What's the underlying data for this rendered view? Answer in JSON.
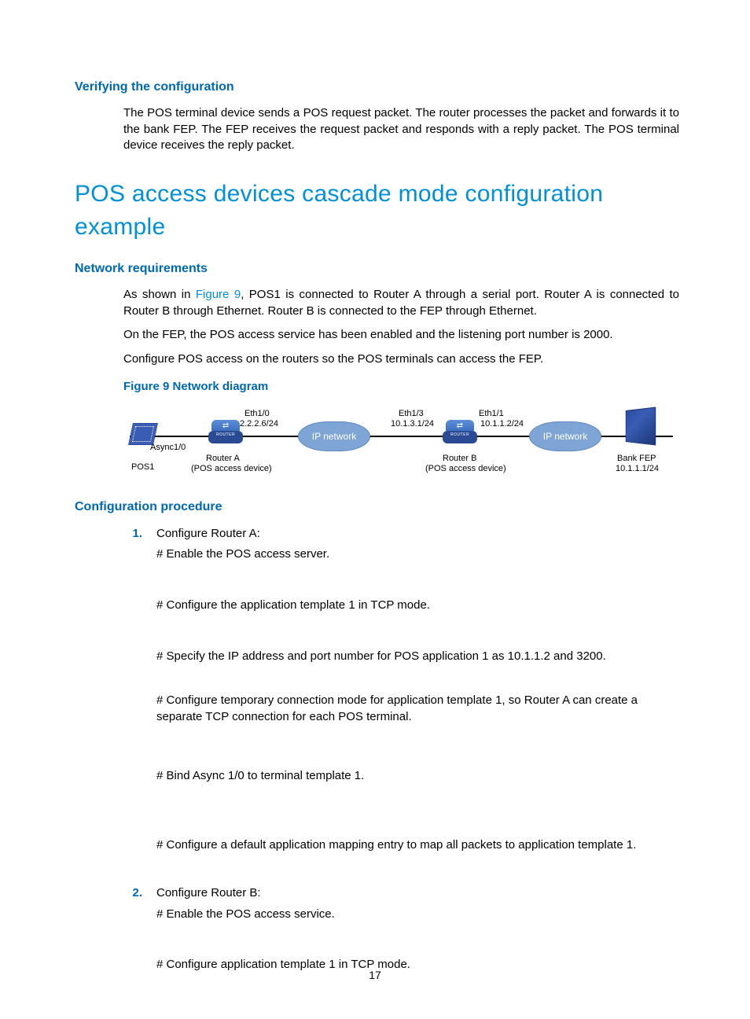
{
  "sec1": {
    "title": "Verifying the configuration",
    "p1": "The POS terminal device sends a POS request packet. The router processes the packet and forwards it to the bank FEP. The FEP receives the request packet and responds with a reply packet. The POS terminal device receives the reply packet."
  },
  "h2": "POS access devices cascade mode configuration example",
  "sec2": {
    "title": "Network requirements",
    "p1a": "As shown in ",
    "figref": "Figure 9",
    "p1b": ", POS1 is connected to Router A through a serial port. Router A is connected to Router B through Ethernet. Router B is connected to the FEP through Ethernet.",
    "p2": "On the FEP, the POS access service has been enabled and the listening port number is 2000.",
    "p3": "Configure POS access on the routers so the POS terminals can access the FEP."
  },
  "figcap": "Figure 9 Network diagram",
  "diagram": {
    "pos1_iface": "Async1/0",
    "pos1": "POS1",
    "ra_eth": "Eth1/0",
    "ra_ip": "2.2.2.6/24",
    "ra_name": "Router  A",
    "ra_sub": "(POS access device)",
    "cloud1": "IP network",
    "rb_left_eth": "Eth1/3",
    "rb_left_ip": "10.1.3.1/24",
    "rb_right_eth": "Eth1/1",
    "rb_right_ip": "10.1.1.2/24",
    "rb_name": "Router B",
    "rb_sub": "(POS access device)",
    "cloud2": "IP network",
    "fep_name": "Bank FEP",
    "fep_ip": "10.1.1.1/24"
  },
  "sec3": {
    "title": "Configuration procedure",
    "items": [
      {
        "num": "1.",
        "title": "Configure Router A:",
        "steps": [
          "# Enable the POS access server.",
          "# Configure the application template 1 in TCP mode.",
          "# Specify the IP address and port number for POS application 1 as 10.1.1.2 and 3200.",
          "# Configure temporary connection mode for application template 1, so Router A can create a separate TCP connection for each POS terminal.",
          "# Bind Async 1/0 to terminal template 1.",
          "# Configure a default application mapping entry to map all packets to application template 1."
        ]
      },
      {
        "num": "2.",
        "title": "Configure Router B:",
        "steps": [
          "# Enable the POS access service.",
          "# Configure application template 1 in TCP mode."
        ]
      }
    ]
  },
  "pagenum": "17"
}
